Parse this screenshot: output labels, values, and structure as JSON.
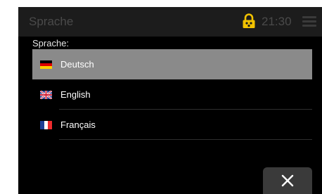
{
  "header": {
    "title": "Sprache",
    "time": "21:30",
    "lock_icon": "lock-icon",
    "menu_icon": "hamburger-menu-icon",
    "accent_color": "#f2c200"
  },
  "section": {
    "label": "Sprache:"
  },
  "languages": [
    {
      "label": "Deutsch",
      "flag": "flag-germany-icon",
      "selected": true
    },
    {
      "label": "English",
      "flag": "flag-uk-icon",
      "selected": false
    },
    {
      "label": "Français",
      "flag": "flag-france-icon",
      "selected": false
    }
  ],
  "footer": {
    "close_icon": "close-icon"
  },
  "colors": {
    "selected_row": "#8a8a8a",
    "background": "#000000",
    "header_bg": "#1c1c1c"
  }
}
